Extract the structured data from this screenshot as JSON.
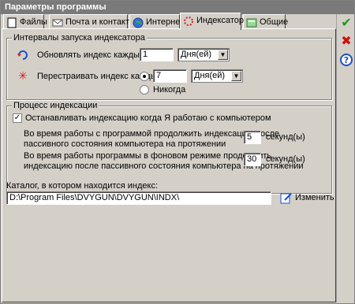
{
  "window": {
    "title": "Параметры программы"
  },
  "tabs": [
    {
      "label": "Файлы",
      "icon": "file-icon"
    },
    {
      "label": "Почта и контакты",
      "icon": "mail-icon"
    },
    {
      "label": "Интернет",
      "icon": "globe-icon"
    },
    {
      "label": "Индексатор",
      "icon": "indexer-icon"
    },
    {
      "label": "Общие",
      "icon": "general-icon"
    }
  ],
  "active_tab": "Индексатор",
  "side": {
    "ok_icon": "check-icon",
    "cancel_icon": "close-icon",
    "help_icon": "help-icon"
  },
  "intervals": {
    "title": "Интервалы запуска индексатора",
    "update_label": "Обновлять индекс каждые:",
    "update_value": "1",
    "update_unit": "Дня(ей)",
    "rebuild_label": "Перестраивать индекс каждые:",
    "rebuild_value": "7",
    "rebuild_unit": "Дня(ей)",
    "never_label": "Никогда"
  },
  "process": {
    "title": "Процесс индексации",
    "stop_label": "Останавливать индексацию когда Я работаю с компьютером",
    "fg_text_1": "Во время работы с программой продолжить индексацию после",
    "fg_text_2": "пассивного состояния компьютера на протяжении",
    "fg_value": "5",
    "fg_unit": "секунд(ы)",
    "bg_text_1": "Во время работы программы в фоновом режиме продолжить",
    "bg_text_2": "индексацию после пассивного состояния компьютера на протяжении",
    "bg_value": "30",
    "bg_unit": "секунд(ы)"
  },
  "catalog": {
    "label": "Каталог, в котором находится индекс:",
    "path": "D:\\Program Files\\DVYGUN\\DVYGUN\\INDX\\",
    "change_label": "Изменить"
  }
}
